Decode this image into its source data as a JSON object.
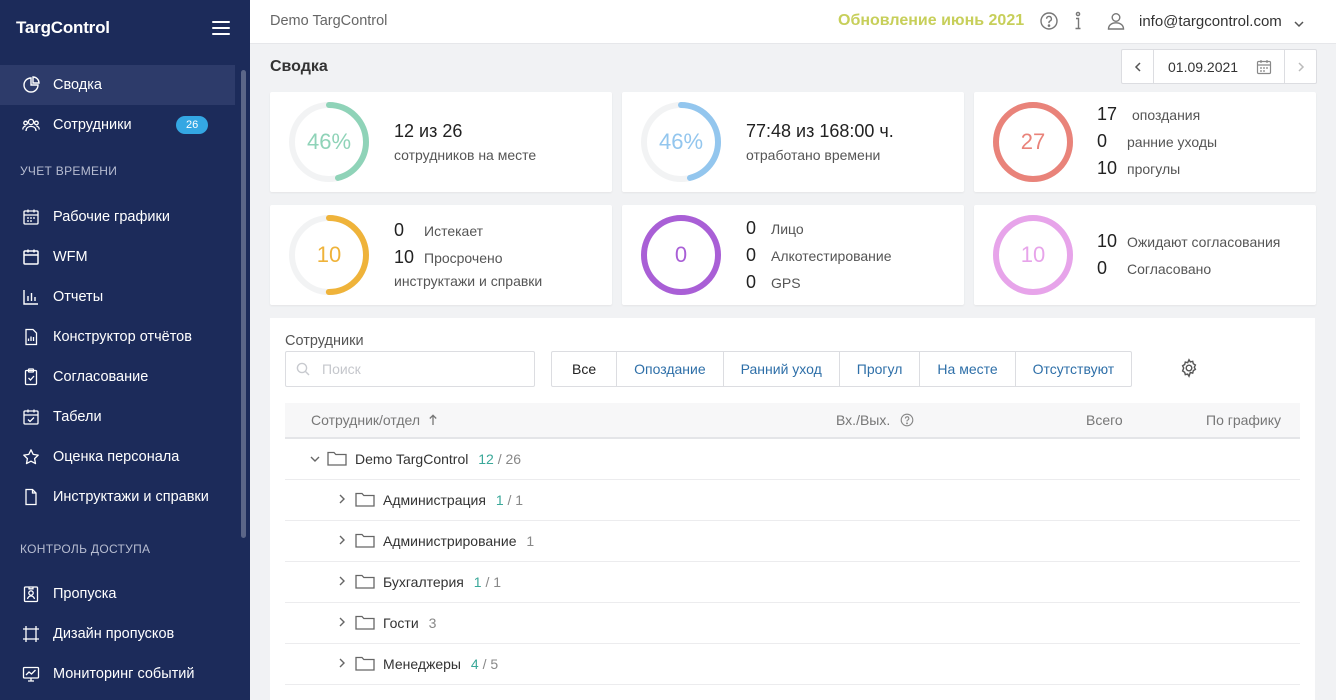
{
  "sidebar": {
    "logo": "TargControl",
    "items_main": [
      {
        "label": "Сводка",
        "icon": "pie-chart-icon",
        "active": true
      },
      {
        "label": "Сотрудники",
        "icon": "users-icon",
        "badge": "26"
      }
    ],
    "section_time": "УЧЕТ ВРЕМЕНИ",
    "items_time": [
      {
        "label": "Рабочие графики",
        "icon": "calendar-grid-icon"
      },
      {
        "label": "WFM",
        "icon": "calendar-icon"
      },
      {
        "label": "Отчеты",
        "icon": "bar-chart-icon"
      },
      {
        "label": "Конструктор отчётов",
        "icon": "report-builder-icon"
      },
      {
        "label": "Согласование",
        "icon": "clipboard-check-icon"
      },
      {
        "label": "Табели",
        "icon": "timesheet-icon"
      },
      {
        "label": "Оценка персонала",
        "icon": "star-icon"
      },
      {
        "label": "Инструктажи и справки",
        "icon": "document-icon"
      }
    ],
    "section_access": "КОНТРОЛЬ ДОСТУПА",
    "items_access": [
      {
        "label": "Пропуска",
        "icon": "badge-icon"
      },
      {
        "label": "Дизайн пропусков",
        "icon": "design-icon"
      },
      {
        "label": "Мониторинг событий",
        "icon": "monitor-icon"
      }
    ]
  },
  "topbar": {
    "company": "Demo TargControl",
    "update": "Обновление июнь 2021",
    "email": "info@targcontrol.com"
  },
  "page": {
    "title": "Сводка",
    "date": "01.09.2021"
  },
  "cards": {
    "presence": {
      "ring": "46%",
      "fraction": 0.46,
      "color": "#8fd3b8",
      "big": "12 из 26",
      "sub": "сотрудников на месте"
    },
    "worked": {
      "ring": "46%",
      "fraction": 0.46,
      "color": "#93c6ee",
      "big": "77:48 из 168:00 ч.",
      "sub": "отработано времени"
    },
    "violations": {
      "ring": "27",
      "fraction": 1,
      "color": "#e9837a",
      "rows": [
        {
          "num": "17",
          "label": "опоздания"
        },
        {
          "num": "0",
          "label": "ранние уходы"
        },
        {
          "num": "10",
          "label": "прогулы"
        }
      ]
    },
    "briefings": {
      "ring": "10",
      "fraction": 0.5,
      "color": "#efb33a",
      "rows": [
        {
          "num": "0",
          "label": "Истекает"
        },
        {
          "num": "10",
          "label": "Просрочено"
        }
      ],
      "sub": "инструктажи и справки"
    },
    "verification": {
      "ring": "0",
      "fraction": 1,
      "color": "#a95fd6",
      "rows": [
        {
          "num": "0",
          "label": "Лицо"
        },
        {
          "num": "0",
          "label": "Алкотестирование"
        },
        {
          "num": "0",
          "label": "GPS"
        }
      ]
    },
    "approvals": {
      "ring": "10",
      "fraction": 1,
      "color": "#e7a4ea",
      "rows": [
        {
          "num": "10",
          "label": "Ожидают согласования"
        },
        {
          "num": "0",
          "label": "Согласовано"
        }
      ]
    }
  },
  "employees": {
    "title": "Сотрудники",
    "search_placeholder": "Поиск",
    "filters": [
      "Все",
      "Опоздание",
      "Ранний уход",
      "Прогул",
      "На месте",
      "Отсутствуют"
    ],
    "columns": {
      "employee": "Сотрудник/отдел",
      "inout": "Вх./Вых.",
      "total": "Всего",
      "schedule": "По графику"
    },
    "root": {
      "name": "Demo TargControl",
      "present": "12",
      "total": "26"
    },
    "departments": [
      {
        "name": "Администрация",
        "present": "1",
        "total": "1"
      },
      {
        "name": "Администрирование",
        "present": "",
        "total": "1"
      },
      {
        "name": "Бухгалтерия",
        "present": "1",
        "total": "1"
      },
      {
        "name": "Гости",
        "present": "",
        "total": "3"
      },
      {
        "name": "Менеджеры",
        "present": "4",
        "total": "5"
      }
    ]
  }
}
